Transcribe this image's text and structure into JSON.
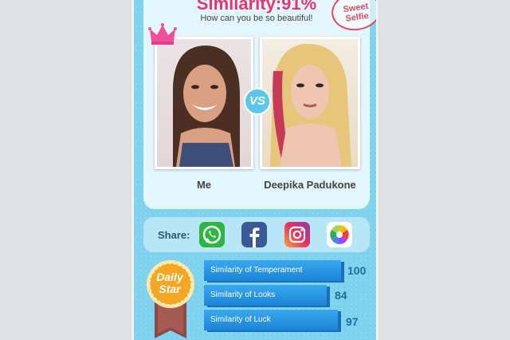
{
  "header": {
    "title": "Similarity:91%",
    "subtitle": "How can you be so beautiful!",
    "stamp_line1": "Sweet",
    "stamp_line2": "Selfie"
  },
  "comparison": {
    "vs_label": "VS",
    "left_name": "Me",
    "right_name": "Deepika Padukone"
  },
  "share": {
    "label": "Share:",
    "icons": [
      "whatsapp-icon",
      "facebook-icon",
      "instagram-icon",
      "photos-icon"
    ]
  },
  "badge": {
    "line1": "Daily",
    "line2": "Star"
  },
  "stats": [
    {
      "label": "Similarity of Temperament",
      "value": "100"
    },
    {
      "label": "Similarity of Looks",
      "value": "84"
    },
    {
      "label": "Similarity of Luck",
      "value": "97"
    }
  ],
  "colors": {
    "accent": "#e8356f",
    "background": "#7fd2ee",
    "bar": "#1c84d6"
  }
}
